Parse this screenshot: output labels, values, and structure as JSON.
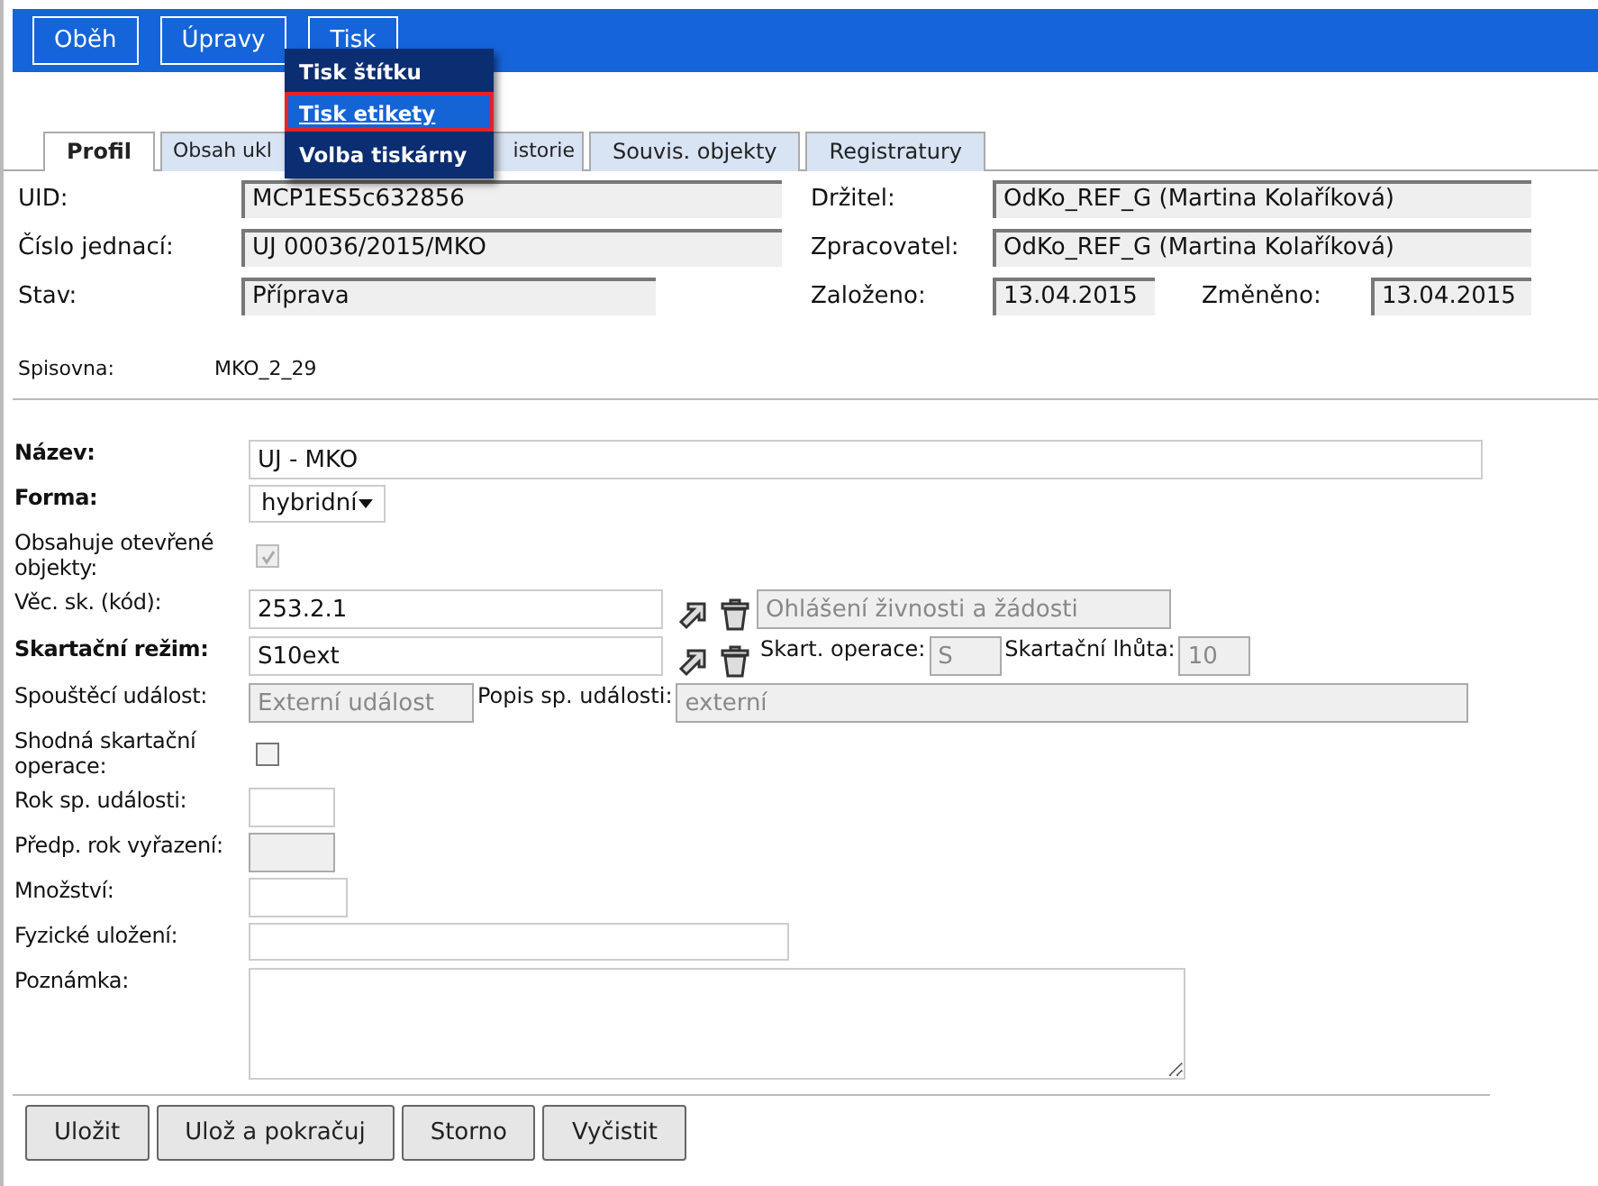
{
  "toolbar": {
    "buttons": [
      {
        "label": "Oběh"
      },
      {
        "label": "Úpravy"
      },
      {
        "label": "Tisk"
      }
    ]
  },
  "print_menu": {
    "items": [
      {
        "label": "Tisk štítku",
        "selected": false
      },
      {
        "label": "Tisk etikety",
        "selected": true
      },
      {
        "label": "Volba tiskárny",
        "selected": false
      }
    ]
  },
  "tabs": [
    {
      "label": "Profil",
      "selected": true
    },
    {
      "label": "Obsah ukl",
      "selected": false
    },
    {
      "label": "istorie",
      "selected": false
    },
    {
      "label": "Souvis. objekty",
      "selected": false
    },
    {
      "label": "Registratury",
      "selected": false
    }
  ],
  "summary": {
    "uid": {
      "label": "UID:",
      "value": "MCP1ES5c632856"
    },
    "reference": {
      "label": "Číslo jednací:",
      "value": "UJ 00036/2015/MKO"
    },
    "state": {
      "label": "Stav:",
      "value": "Příprava"
    },
    "holder": {
      "label": "Držitel:",
      "value": "OdKo_REF_G (Martina Kolaříková)"
    },
    "processor": {
      "label": "Zpracovatel:",
      "value": "OdKo_REF_G (Martina Kolaříková)"
    },
    "created": {
      "label": "Založeno:",
      "value": "13.04.2015"
    },
    "changed": {
      "label": "Změněno:",
      "value": "13.04.2015"
    },
    "registry": {
      "label": "Spisovna:",
      "value": "MKO_2_29"
    }
  },
  "form": [
    {
      "kind": "wide",
      "label": "Název:",
      "bold": true,
      "value": "UJ - MKO"
    },
    {
      "kind": "select",
      "label": "Forma:",
      "bold": true,
      "value": "hybridní"
    },
    {
      "kind": "checkbox",
      "label": "Obsahuje otevřené objekty:",
      "bold": false,
      "checked": true,
      "disabled": true
    },
    {
      "kind": "class",
      "label": "Věc. sk. (kód):",
      "bold": false,
      "value": "253.2.1",
      "extra": "Ohlášení živnosti a žádosti"
    },
    {
      "kind": "regime",
      "label": "Skartační režim:",
      "bold": true,
      "value": "S10ext",
      "op_label": "Skart. operace:",
      "op_value": "S",
      "period_label": "Skartační lhůta:",
      "period_value": "10"
    },
    {
      "kind": "event",
      "label": "Spouštěcí událost:",
      "bold": false,
      "value": "Externí událost",
      "desc_label": "Popis sp. události:",
      "desc_value": "externí"
    },
    {
      "kind": "checkbox",
      "label": "Shodná skartační operace:",
      "bold": false,
      "checked": false,
      "disabled": false
    },
    {
      "kind": "year",
      "label": "Rok sp. události:",
      "bold": false
    },
    {
      "kind": "year_disabled",
      "label": "Předp. rok vyřazení:",
      "bold": false
    },
    {
      "kind": "amount",
      "label": "Množství:",
      "bold": false
    },
    {
      "kind": "medium",
      "label": "Fyzické uložení:",
      "bold": false
    },
    {
      "kind": "note",
      "label": "Poznámka:",
      "bold": false
    }
  ],
  "actions": [
    {
      "label": "Uložit"
    },
    {
      "label": "Ulož a pokračuj"
    },
    {
      "label": "Storno"
    },
    {
      "label": "Vyčistit"
    }
  ]
}
